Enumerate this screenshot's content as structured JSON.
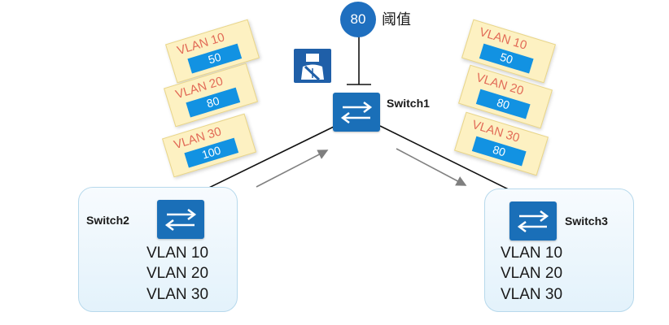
{
  "threshold": {
    "value": "80",
    "label": "阈值"
  },
  "switch1": {
    "name": "Switch1"
  },
  "switch2": {
    "name": "Switch2",
    "vlans": [
      "VLAN 10",
      "VLAN 20",
      "VLAN 30"
    ],
    "tags": [
      {
        "vlan": "VLAN 10",
        "value": "50"
      },
      {
        "vlan": "VLAN 20",
        "value": "80"
      },
      {
        "vlan": "VLAN 30",
        "value": "100"
      }
    ]
  },
  "switch3": {
    "name": "Switch3",
    "vlans": [
      "VLAN 10",
      "VLAN 20",
      "VLAN 30"
    ],
    "tags": [
      {
        "vlan": "VLAN 10",
        "value": "50"
      },
      {
        "vlan": "VLAN 20",
        "value": "80"
      },
      {
        "vlan": "VLAN 30",
        "value": "80"
      }
    ]
  },
  "colors": {
    "switch_blue": "#1a6fb8",
    "tag_fill": "#fdf1c2",
    "tag_text": "#e26b57",
    "value_fill": "#1292e2",
    "threshold_fill": "#1f6fbf"
  },
  "icons": {
    "switch": "switch-arrows-icon",
    "guard": "seatbelt-person-icon"
  }
}
